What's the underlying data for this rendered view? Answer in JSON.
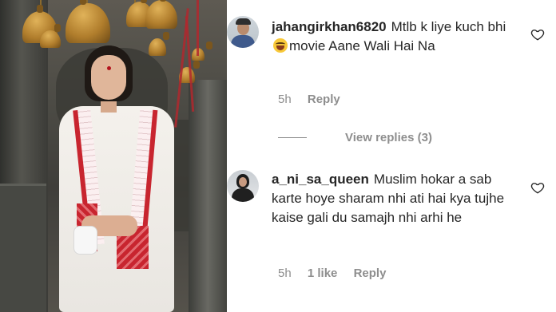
{
  "comments": [
    {
      "username": "jahangirkhan6820",
      "text_before_emoji": "Mtlb k liye kuch bhi",
      "emoji": "face-with-tears-of-joy",
      "text_after_emoji": "movie Aane Wali Hai Na",
      "time": "5h",
      "reply_label": "Reply",
      "view_replies_label": "View replies (3)"
    },
    {
      "username": "a_ni_sa_queen",
      "text": "Muslim hokar a sab karte hoye sharam nhi ati hai kya tujhe kaise gali du samajh nhi arhi he",
      "time": "5h",
      "likes": "1 like",
      "reply_label": "Reply"
    }
  ],
  "icons": {
    "like": "heart-outline-icon"
  },
  "colors": {
    "text": "#262626",
    "secondary": "#8e8e8e",
    "background": "#ffffff"
  }
}
